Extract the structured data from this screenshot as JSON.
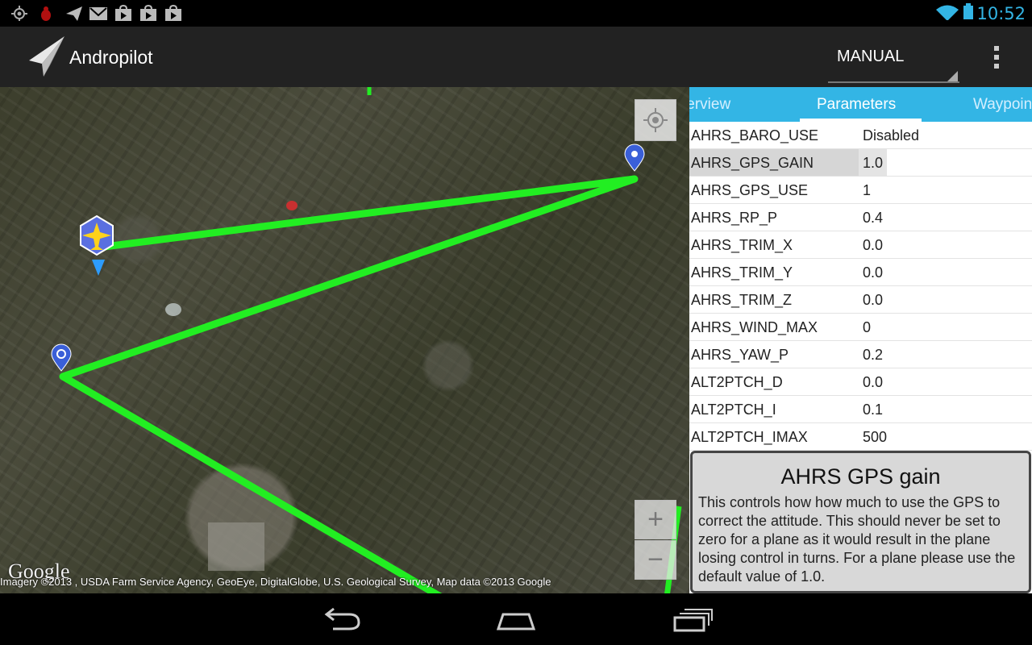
{
  "status_bar": {
    "time": "10:52",
    "icons": [
      "gps-icon",
      "bug-icon",
      "send-icon",
      "gmail-icon",
      "play-store-icon",
      "play-store-icon",
      "play-store-icon",
      "wifi-icon",
      "battery-icon"
    ]
  },
  "action_bar": {
    "title": "Andropilot",
    "mode": "MANUAL"
  },
  "map": {
    "logo": "Google",
    "attribution": "Imagery ©2013 , USDA Farm Service Agency, GeoEye, DigitalGlobe, U.S. Geological Survey, Map data ©2013 Google",
    "zoom_in": "+",
    "zoom_out": "−",
    "flight_path_color": "#22ee22"
  },
  "tabs": {
    "overview": "Overview",
    "parameters": "Parameters",
    "waypoints": "Waypoints",
    "active": "Parameters"
  },
  "parameters": [
    {
      "name": "AHRS_BARO_USE",
      "value": "Disabled"
    },
    {
      "name": "AHRS_GPS_GAIN",
      "value": "1.0"
    },
    {
      "name": "AHRS_GPS_USE",
      "value": "1"
    },
    {
      "name": "AHRS_RP_P",
      "value": "0.4"
    },
    {
      "name": "AHRS_TRIM_X",
      "value": "0.0"
    },
    {
      "name": "AHRS_TRIM_Y",
      "value": "0.0"
    },
    {
      "name": "AHRS_TRIM_Z",
      "value": "0.0"
    },
    {
      "name": "AHRS_WIND_MAX",
      "value": "0"
    },
    {
      "name": "AHRS_YAW_P",
      "value": "0.2"
    },
    {
      "name": "ALT2PTCH_D",
      "value": "0.0"
    },
    {
      "name": "ALT2PTCH_I",
      "value": "0.1"
    },
    {
      "name": "ALT2PTCH_IMAX",
      "value": "500"
    }
  ],
  "selected_parameter": "AHRS_GPS_GAIN",
  "help": {
    "title": "AHRS GPS gain",
    "text": "This controls how how much to use the GPS to correct the attitude. This should never be set to zero for a plane as it would result in the plane losing control in turns. For a plane please use the default value of 1.0."
  },
  "colors": {
    "accent": "#33b5e5",
    "action_bar": "#222222"
  }
}
